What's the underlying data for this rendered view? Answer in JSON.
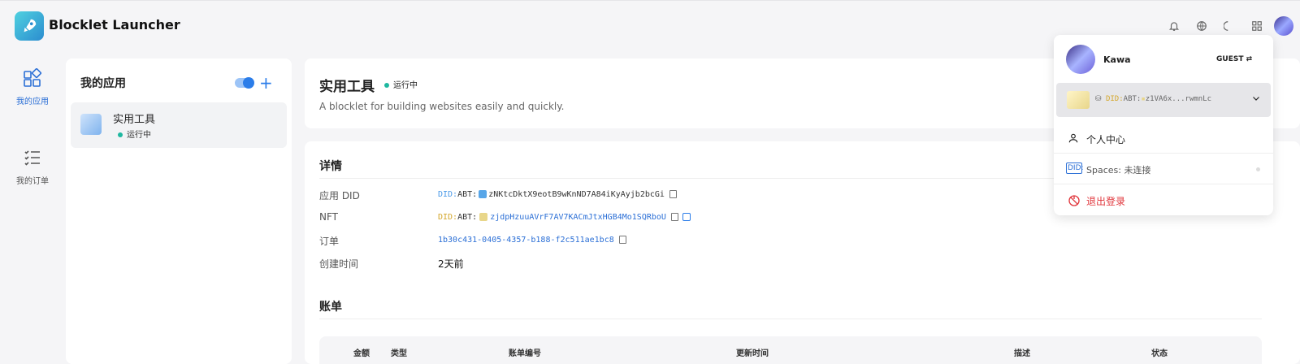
{
  "header": {
    "brand": "Blocklet Launcher"
  },
  "nav": [
    {
      "label": "我的应用",
      "icon": "apps-icon",
      "active": true
    },
    {
      "label": "我的订单",
      "icon": "orders-list-icon",
      "active": false
    }
  ],
  "apps_panel": {
    "title": "我的应用",
    "apps": [
      {
        "name": "实用工具",
        "status": "运行中"
      }
    ]
  },
  "app_header": {
    "title": "实用工具",
    "status": "运行中",
    "description": "A blocklet for building websites easily and quickly."
  },
  "details": {
    "title": "详情",
    "rows": {
      "app_did": {
        "label": "应用 DID",
        "prefix": "DID:",
        "prefix2": "ABT:",
        "value": "zNKtcDktX9eotB9wKnND7A84iKyAyjb2bcGi"
      },
      "nft": {
        "label": "NFT",
        "prefix": "DID:",
        "prefix2": "ABT:",
        "value": "zjdpHzuuAVrF7AV7KACmJtxHGB4Mo1SQRboU"
      },
      "order": {
        "label": "订单",
        "value": "1b30c431-0405-4357-b188-f2c511ae1bc8"
      },
      "created": {
        "label": "创建时间",
        "value": "2天前"
      }
    }
  },
  "bill": {
    "title": "账单",
    "columns": [
      "金额",
      "类型",
      "账单编号",
      "更新时间",
      "描述",
      "状态"
    ]
  },
  "user_menu": {
    "name": "Kawa",
    "role": "GUEST",
    "did_prefix": "DID:",
    "did_prefix2": "ABT:",
    "did_value": "z1VA6x...rwmnLc",
    "items": [
      {
        "label": "个人中心",
        "icon": "user-icon"
      },
      {
        "label": "Spaces: 未连接",
        "prefix": "DID:",
        "icon": "did-spaces-icon"
      },
      {
        "label": "退出登录",
        "icon": "logout-icon",
        "color": "#e0353b"
      }
    ]
  }
}
